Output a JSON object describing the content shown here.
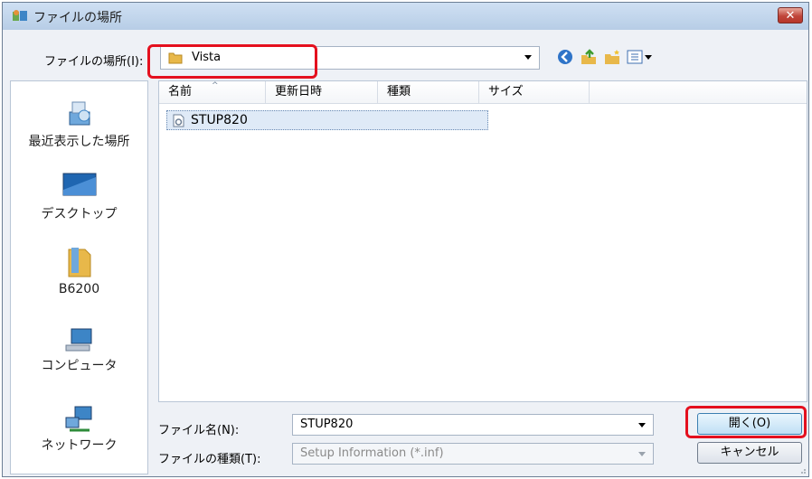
{
  "window": {
    "title": "ファイルの場所",
    "close_label": "✕"
  },
  "location": {
    "label": "ファイルの場所(I):",
    "value": "Vista"
  },
  "toolbar": {
    "icons": [
      "back-icon",
      "up-folder-icon",
      "new-folder-icon",
      "view-menu-icon"
    ]
  },
  "places": [
    {
      "label": "最近表示した場所",
      "icon": "recent-places-icon"
    },
    {
      "label": "デスクトップ",
      "icon": "desktop-icon"
    },
    {
      "label": "B6200",
      "icon": "user-folder-icon"
    },
    {
      "label": "コンピュータ",
      "icon": "computer-icon"
    },
    {
      "label": "ネットワーク",
      "icon": "network-icon"
    }
  ],
  "columns": [
    "名前",
    "更新日時",
    "種類",
    "サイズ"
  ],
  "files": [
    {
      "name": "STUP820",
      "icon": "setup-file-icon"
    }
  ],
  "filename": {
    "label": "ファイル名(N):",
    "value": "STUP820"
  },
  "filetype": {
    "label": "ファイルの種類(T):",
    "value": "Setup Information (*.inf)"
  },
  "buttons": {
    "open": "開く(O)",
    "cancel": "キャンセル"
  },
  "colors": {
    "highlight": "#e4101e",
    "title_bar": "#c4d7ee",
    "selection": "#dfeaf7"
  }
}
